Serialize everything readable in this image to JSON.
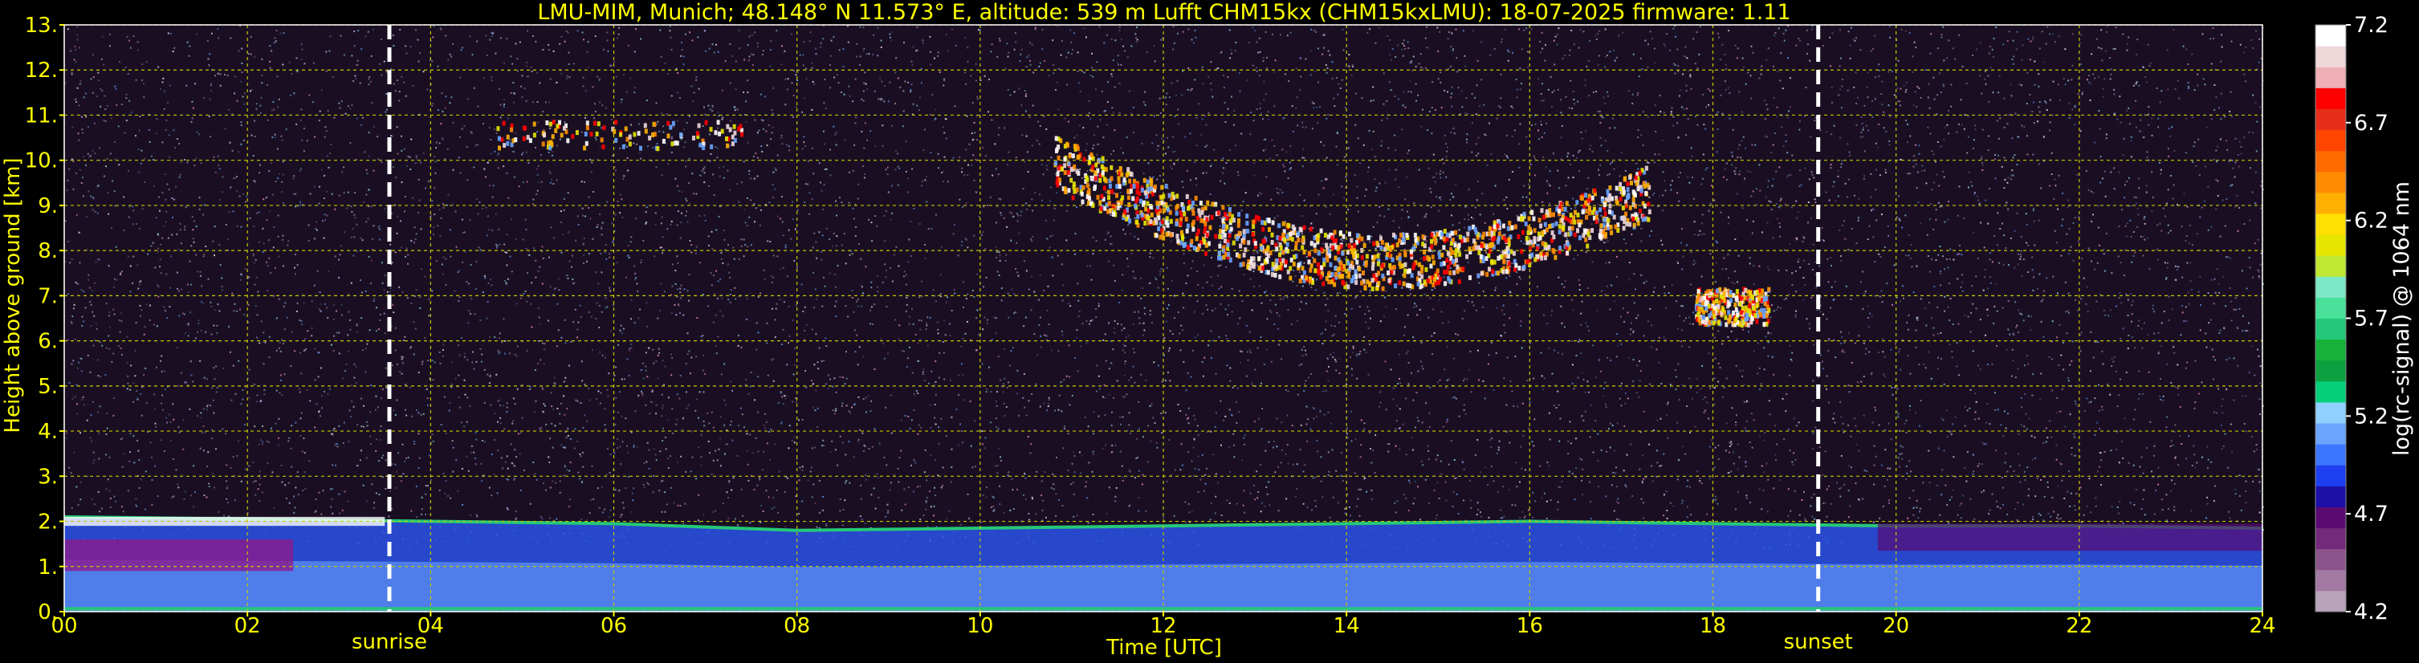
{
  "chart_data": {
    "type": "heatmap",
    "title": "LMU-MIM, Munich; 48.148° N 11.573° E, altitude: 539 m    Lufft CHM15kx (CHM15kxLMU): 18-07-2025    firmware: 1.11",
    "xlabel": "Time [UTC]",
    "ylabel": "Height above ground [km]",
    "xlim": [
      0,
      24
    ],
    "ylim": [
      0,
      13
    ],
    "x_ticks": [
      "00",
      "02",
      "04",
      "06",
      "08",
      "10",
      "12",
      "14",
      "16",
      "18",
      "20",
      "22",
      "24"
    ],
    "y_ticks": [
      "0.",
      "1.",
      "2.",
      "3.",
      "4.",
      "5.",
      "6.",
      "7.",
      "8.",
      "9.",
      "10.",
      "11.",
      "12.",
      "13."
    ],
    "grid": true,
    "colorbar": {
      "label": "log(rc-signal) @ 1064 nm",
      "range": [
        4.2,
        7.2
      ],
      "ticks": [
        "4.2",
        "4.7",
        "5.2",
        "5.7",
        "6.2",
        "6.7",
        "7.2"
      ],
      "colors": [
        "#b8a3b8",
        "#a37aa3",
        "#8c548c",
        "#732a7a",
        "#5a0b72",
        "#1c10a8",
        "#1d3ff0",
        "#3b76ff",
        "#6aa4ff",
        "#8fd0ff",
        "#06cf7a",
        "#0ea040",
        "#15b13a",
        "#25c878",
        "#49e09a",
        "#7ee8c7",
        "#c0e833",
        "#e6e600",
        "#ffe000",
        "#ffb000",
        "#ff8c00",
        "#ff6a00",
        "#ff4500",
        "#e62e1a",
        "#ff0000",
        "#eeb0b4",
        "#f0d8da",
        "#ffffff"
      ]
    },
    "annotations": [
      {
        "text": "sunrise",
        "x": 3.55
      },
      {
        "text": "sunset",
        "x": 19.15
      }
    ],
    "boundary_layer": [
      [
        0,
        2.1
      ],
      [
        2,
        2.05
      ],
      [
        4,
        2.0
      ],
      [
        6,
        1.95
      ],
      [
        8,
        1.8
      ],
      [
        10,
        1.85
      ],
      [
        12,
        1.9
      ],
      [
        14,
        1.95
      ],
      [
        16,
        2.0
      ],
      [
        18,
        1.95
      ],
      [
        20,
        1.9
      ],
      [
        22,
        1.9
      ],
      [
        24,
        1.85
      ]
    ],
    "cloud_layers": [
      {
        "x_start": 4.7,
        "x_end": 7.4,
        "y_low": 10.3,
        "y_high": 10.9
      },
      {
        "x_start": 10.8,
        "x_end": 17.3,
        "y_low": 7.0,
        "y_high": 10.4
      },
      {
        "x_start": 17.8,
        "x_end": 18.6,
        "y_low": 6.4,
        "y_high": 7.2
      }
    ]
  }
}
